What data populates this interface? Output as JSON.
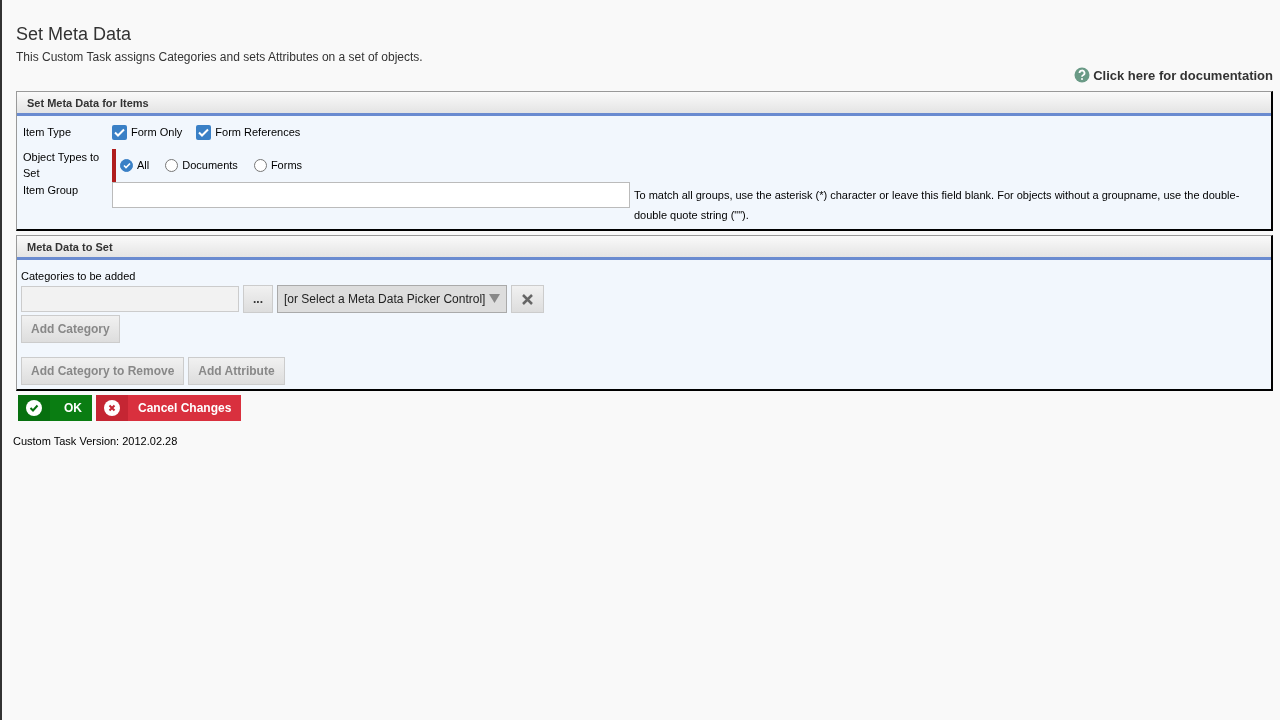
{
  "title": "Set Meta Data",
  "description": "This Custom Task assigns Categories and sets Attributes on a set of objects.",
  "doc_link": "Click here for documentation",
  "items_section": {
    "header": "Set Meta Data for Items",
    "item_type": {
      "label": "Item Type",
      "options": [
        {
          "label": "Form Only",
          "checked": true
        },
        {
          "label": "Form References",
          "checked": true
        }
      ]
    },
    "object_types": {
      "label": "Object Types to Set",
      "required": true,
      "options": [
        {
          "label": "All",
          "selected": true
        },
        {
          "label": "Documents",
          "selected": false
        },
        {
          "label": "Forms",
          "selected": false
        }
      ]
    },
    "item_group": {
      "label": "Item Group",
      "hint": "To match all groups, use the asterisk (*) character or leave this field blank. For objects without a groupname, use the double-double quote string (\"\")."
    }
  },
  "meta_section": {
    "header": "Meta Data to Set",
    "categories_label": "Categories to be added",
    "browse_button": "...",
    "picker": "[or Select a Meta Data Picker Control]",
    "button_rows": [
      [
        {
          "label": "Add Category",
          "disabled": true
        }
      ],
      [
        {
          "label": "Add Category to Remove",
          "disabled": true
        },
        {
          "label": "Add Attribute",
          "disabled": true
        }
      ]
    ]
  },
  "actions": [
    {
      "kind": "ok",
      "label": "OK"
    },
    {
      "kind": "cancel",
      "label": "Cancel Changes"
    }
  ],
  "version": "Custom Task Version: 2012.02.28"
}
